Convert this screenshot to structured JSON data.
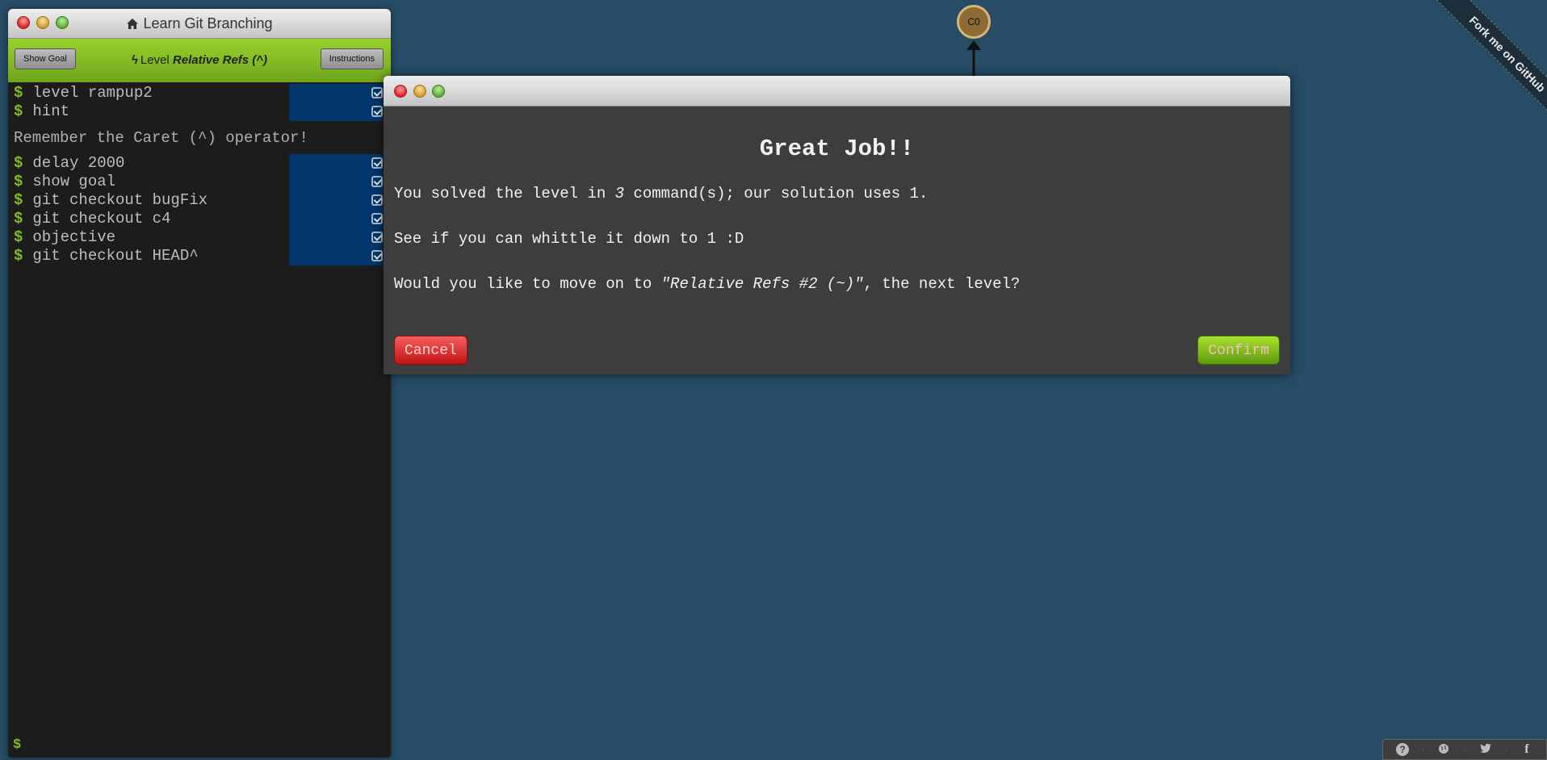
{
  "terminal": {
    "title": "Learn Git Branching",
    "show_goal_label": "Show Goal",
    "instructions_label": "Instructions",
    "level_prefix": "Level",
    "level_name": "Relative Refs (^)",
    "history_top": [
      {
        "cmd": "level rampup2"
      },
      {
        "cmd": "hint"
      }
    ],
    "hint_text": "Remember the Caret (^) operator!",
    "history_bottom": [
      {
        "cmd": "delay 2000"
      },
      {
        "cmd": "show goal"
      },
      {
        "cmd": "git checkout bugFix"
      },
      {
        "cmd": "git checkout c4"
      },
      {
        "cmd": "objective"
      },
      {
        "cmd": "git checkout HEAD^"
      }
    ],
    "prompt": "$",
    "accent_green": "#7fbb2a",
    "highlight_blue": "#00366b"
  },
  "graph": {
    "commit_label": "C0"
  },
  "modal": {
    "heading": "Great Job!!",
    "p1_before": "You solved the level in ",
    "p1_count": "3",
    "p1_after": " command(s); our solution uses 1.",
    "p2": "See if you can whittle it down to 1 :D",
    "p3_before": "Would you like to move on to ",
    "p3_level": "\"Relative Refs #2 (~)\"",
    "p3_after": ", the next level?",
    "cancel_label": "Cancel",
    "confirm_label": "Confirm"
  },
  "ribbon": {
    "text": "Fork me on GitHub"
  },
  "footer": {
    "icons": [
      "help-icon",
      "globe-icon",
      "twitter-icon",
      "facebook-icon"
    ],
    "separator": "·"
  }
}
